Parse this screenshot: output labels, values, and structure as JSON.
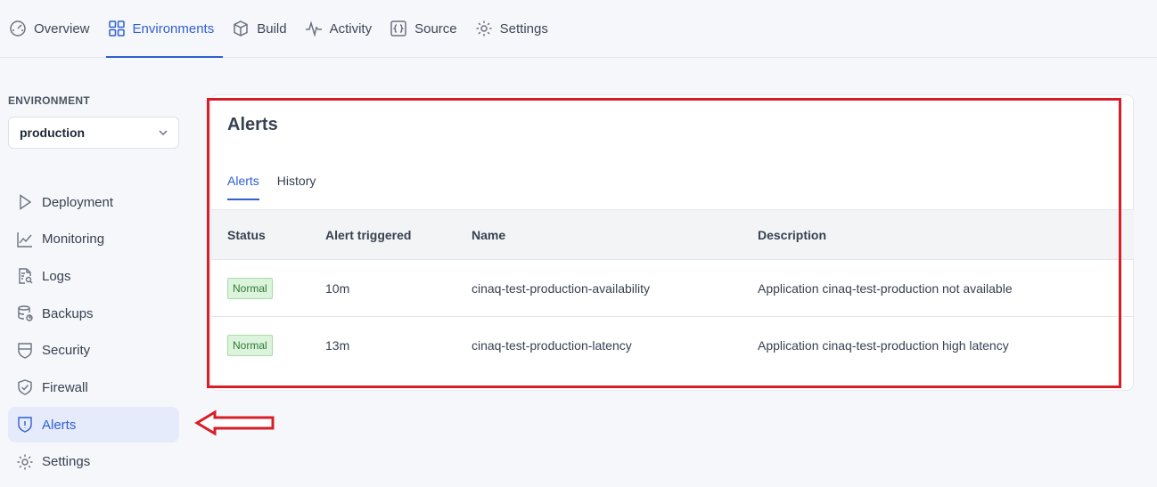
{
  "topnav": {
    "tabs": [
      {
        "label": "Overview",
        "icon": "gauge-icon"
      },
      {
        "label": "Environments",
        "icon": "grid-icon",
        "active": true
      },
      {
        "label": "Build",
        "icon": "box-icon"
      },
      {
        "label": "Activity",
        "icon": "activity-icon"
      },
      {
        "label": "Source",
        "icon": "code-braces-icon"
      },
      {
        "label": "Settings",
        "icon": "gear-icon"
      }
    ]
  },
  "sidebar": {
    "environment_label": "ENVIRONMENT",
    "environment_value": "production",
    "items": [
      {
        "label": "Deployment",
        "icon": "play-icon"
      },
      {
        "label": "Monitoring",
        "icon": "chart-line-icon"
      },
      {
        "label": "Logs",
        "icon": "document-search-icon"
      },
      {
        "label": "Backups",
        "icon": "database-icon"
      },
      {
        "label": "Security",
        "icon": "shield-icon"
      },
      {
        "label": "Firewall",
        "icon": "shield-check-icon"
      },
      {
        "label": "Alerts",
        "icon": "shield-alert-icon",
        "active": true
      },
      {
        "label": "Settings",
        "icon": "gear-icon"
      }
    ]
  },
  "main": {
    "title": "Alerts",
    "tabs": [
      {
        "label": "Alerts",
        "active": true
      },
      {
        "label": "History"
      }
    ],
    "table": {
      "columns": [
        "Status",
        "Alert triggered",
        "Name",
        "Description"
      ],
      "rows": [
        {
          "status": "Normal",
          "triggered": "10m",
          "name": "cinaq-test-production-availability",
          "description": "Application cinaq-test-production not available"
        },
        {
          "status": "Normal",
          "triggered": "13m",
          "name": "cinaq-test-production-latency",
          "description": "Application cinaq-test-production high latency"
        }
      ]
    }
  },
  "colors": {
    "accent": "#2f5fd0",
    "annotation": "#d71e28",
    "status_normal_bg": "#dcf3dc",
    "status_normal_text": "#2f7a36"
  }
}
